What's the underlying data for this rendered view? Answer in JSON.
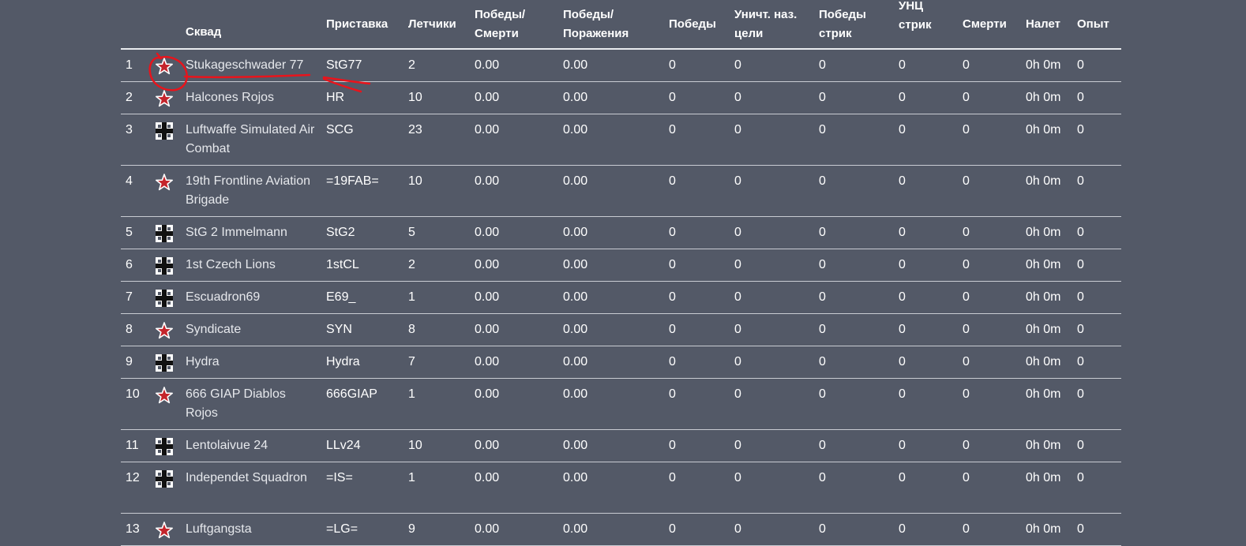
{
  "columns": {
    "squad": "Сквад",
    "tag": "Приставка",
    "pilots": "Летчики",
    "kd": [
      "Победы/",
      "Смерти"
    ],
    "wl": [
      "Победы/",
      "Поражения"
    ],
    "wins": "Победы",
    "ground": [
      "Уничт. наз.",
      "цели"
    ],
    "streak": [
      "Победы",
      "стрик"
    ],
    "gstreak": [
      "УНЦ",
      "стрик"
    ],
    "deaths": "Смерти",
    "flight": "Налет",
    "xp": "Опыт"
  },
  "rows": [
    {
      "rank": "1",
      "emblem": "soviet-star",
      "name": "Stukageschwader 77",
      "tag": "StG77",
      "pilots": "2",
      "kd": "0.00",
      "wl": "0.00",
      "wins": "0",
      "ground": "0",
      "streak": "0",
      "gstreak": "0",
      "deaths": "0",
      "flight": "0h 0m",
      "xp": "0"
    },
    {
      "rank": "2",
      "emblem": "soviet-star",
      "name": "Halcones Rojos",
      "tag": "HR",
      "pilots": "10",
      "kd": "0.00",
      "wl": "0.00",
      "wins": "0",
      "ground": "0",
      "streak": "0",
      "gstreak": "0",
      "deaths": "0",
      "flight": "0h 0m",
      "xp": "0"
    },
    {
      "rank": "3",
      "emblem": "german-cross",
      "name": "Luftwaffe Simulated Air Combat",
      "tag": "SCG",
      "pilots": "23",
      "kd": "0.00",
      "wl": "0.00",
      "wins": "0",
      "ground": "0",
      "streak": "0",
      "gstreak": "0",
      "deaths": "0",
      "flight": "0h 0m",
      "xp": "0"
    },
    {
      "rank": "4",
      "emblem": "soviet-star",
      "name": "19th Frontline Aviation Brigade",
      "tag": "=19FAB=",
      "pilots": "10",
      "kd": "0.00",
      "wl": "0.00",
      "wins": "0",
      "ground": "0",
      "streak": "0",
      "gstreak": "0",
      "deaths": "0",
      "flight": "0h 0m",
      "xp": "0"
    },
    {
      "rank": "5",
      "emblem": "german-cross",
      "name": "StG 2 Immelmann",
      "tag": "StG2",
      "pilots": "5",
      "kd": "0.00",
      "wl": "0.00",
      "wins": "0",
      "ground": "0",
      "streak": "0",
      "gstreak": "0",
      "deaths": "0",
      "flight": "0h 0m",
      "xp": "0"
    },
    {
      "rank": "6",
      "emblem": "german-cross",
      "name": "1st Czech Lions",
      "tag": "1stCL",
      "pilots": "2",
      "kd": "0.00",
      "wl": "0.00",
      "wins": "0",
      "ground": "0",
      "streak": "0",
      "gstreak": "0",
      "deaths": "0",
      "flight": "0h 0m",
      "xp": "0"
    },
    {
      "rank": "7",
      "emblem": "german-cross",
      "name": "Escuadron69",
      "tag": "E69_",
      "pilots": "1",
      "kd": "0.00",
      "wl": "0.00",
      "wins": "0",
      "ground": "0",
      "streak": "0",
      "gstreak": "0",
      "deaths": "0",
      "flight": "0h 0m",
      "xp": "0"
    },
    {
      "rank": "8",
      "emblem": "soviet-star",
      "name": "Syndicate",
      "tag": "SYN",
      "pilots": "8",
      "kd": "0.00",
      "wl": "0.00",
      "wins": "0",
      "ground": "0",
      "streak": "0",
      "gstreak": "0",
      "deaths": "0",
      "flight": "0h 0m",
      "xp": "0"
    },
    {
      "rank": "9",
      "emblem": "german-cross",
      "name": "Hydra",
      "tag": "Hydra",
      "pilots": "7",
      "kd": "0.00",
      "wl": "0.00",
      "wins": "0",
      "ground": "0",
      "streak": "0",
      "gstreak": "0",
      "deaths": "0",
      "flight": "0h 0m",
      "xp": "0"
    },
    {
      "rank": "10",
      "emblem": "soviet-star",
      "name": "666 GIAP Diablos Rojos",
      "tag": "666GIAP",
      "pilots": "1",
      "kd": "0.00",
      "wl": "0.00",
      "wins": "0",
      "ground": "0",
      "streak": "0",
      "gstreak": "0",
      "deaths": "0",
      "flight": "0h 0m",
      "xp": "0"
    },
    {
      "rank": "11",
      "emblem": "german-cross",
      "name": "Lentolaivue 24",
      "tag": "LLv24",
      "pilots": "10",
      "kd": "0.00",
      "wl": "0.00",
      "wins": "0",
      "ground": "0",
      "streak": "0",
      "gstreak": "0",
      "deaths": "0",
      "flight": "0h 0m",
      "xp": "0"
    },
    {
      "rank": "12",
      "emblem": "german-cross",
      "name": "Independet Squadron",
      "tag": "=IS=",
      "pilots": "1",
      "kd": "0.00",
      "wl": "0.00",
      "wins": "0",
      "ground": "0",
      "streak": "0",
      "gstreak": "0",
      "deaths": "0",
      "flight": "0h 0m",
      "xp": "0"
    },
    {
      "rank": "13",
      "emblem": "soviet-star",
      "name": "Luftgangsta",
      "tag": "=LG=",
      "pilots": "9",
      "kd": "0.00",
      "wl": "0.00",
      "wins": "0",
      "ground": "0",
      "streak": "0",
      "gstreak": "0",
      "deaths": "0",
      "flight": "0h 0m",
      "xp": "0"
    }
  ],
  "colors": {
    "background": "#535967",
    "star_fill": "#c4242b",
    "star_outline": "#ffffff",
    "cross_black": "#111111",
    "annotation_red": "#e8141c"
  }
}
